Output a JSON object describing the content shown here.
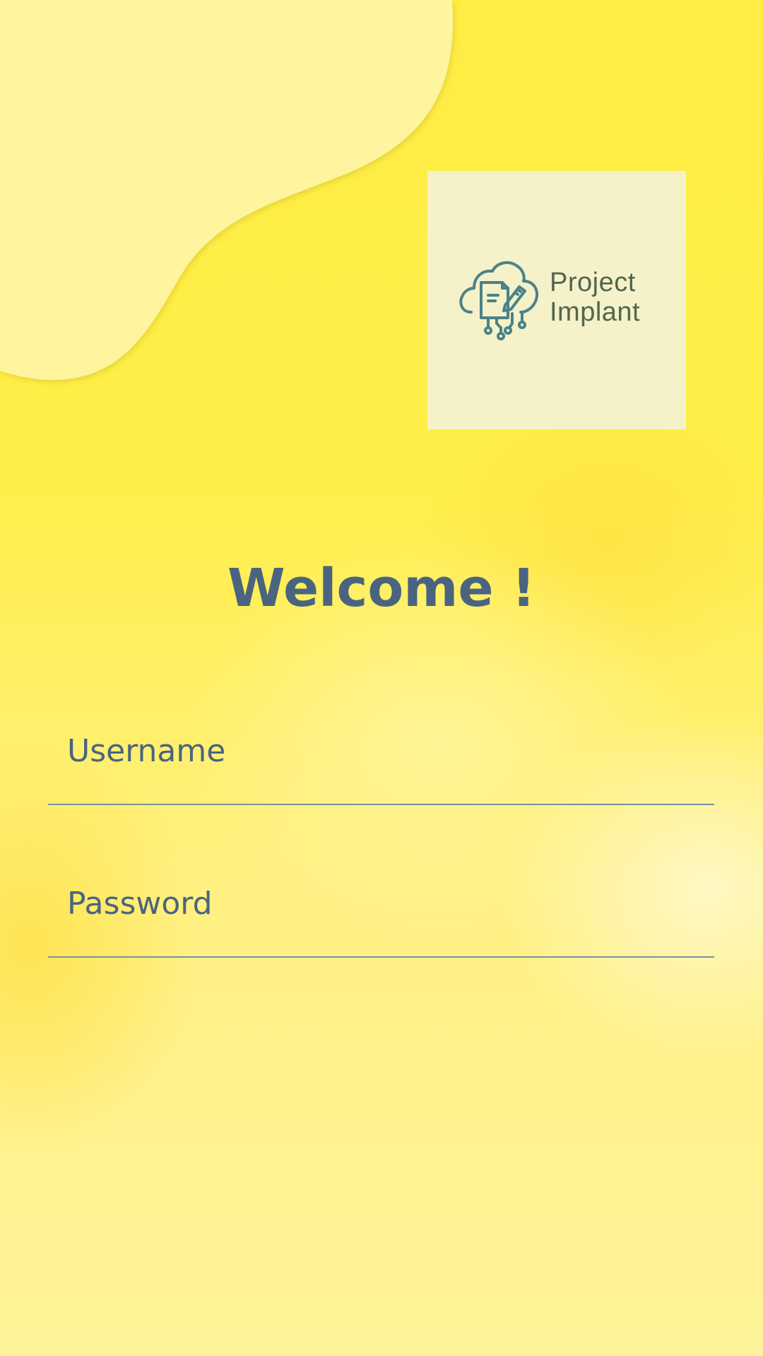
{
  "logo": {
    "icon": "cloud-document-circuit-icon",
    "line1": "Project",
    "line2": "Implant"
  },
  "welcome": "Welcome !",
  "username": {
    "placeholder": "Username",
    "value": ""
  },
  "password": {
    "placeholder": "Password",
    "value": ""
  },
  "colors": {
    "background": "#ffee48",
    "blob": "#fff59f",
    "logo_card": "#f5f1c9",
    "icon": "#4a8289",
    "logo_text": "#52664d",
    "text": "#4a6480",
    "underline": "#7a8fa3"
  }
}
